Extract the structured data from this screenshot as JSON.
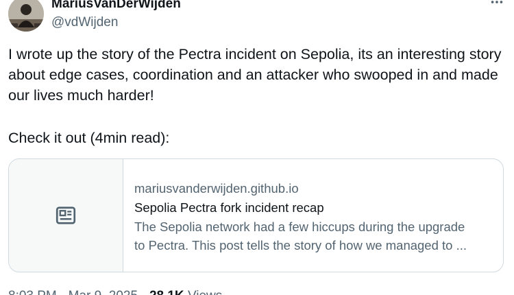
{
  "author": {
    "display_name": "MariusVanDerWijden",
    "handle": "@vdWijden"
  },
  "tweet": {
    "text": "I wrote up the story of the Pectra incident on Sepolia, its an interesting story about edge cases, coordination and an attacker who swooped in and made our lives much harder!",
    "cta": "Check it out (4min read):"
  },
  "link_card": {
    "domain": "mariusvanderwijden.github.io",
    "title": "Sepolia Pectra fork incident recap",
    "description_line1": "The Sepolia network had a few hiccups during the upgrade",
    "description_line2": "to Pectra. This post tells the story of how we managed to ...",
    "thumbnail_icon": "article-icon"
  },
  "footer": {
    "time": "8:03 PM",
    "separator": "·",
    "date": "Mar 9, 2025",
    "views_count": "28.1K",
    "views_label": "Views"
  },
  "icons": {
    "more": "more-icon"
  },
  "colors": {
    "text_primary": "#0f1419",
    "text_secondary": "#536471",
    "border": "#cfd9de"
  }
}
